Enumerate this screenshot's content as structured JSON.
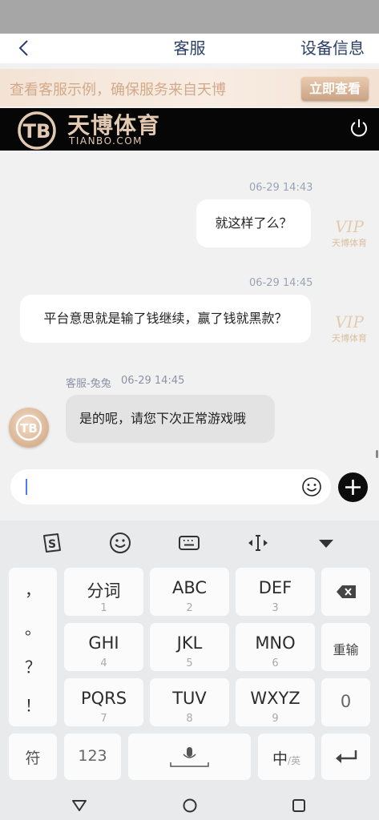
{
  "header": {
    "title": "客服",
    "right_action": "设备信息",
    "back_icon": "chevron-left-icon"
  },
  "promo": {
    "text": "查看客服示例，确保服务来自天博",
    "button": "立即查看"
  },
  "brand": {
    "name_cn": "天博体育",
    "name_en": "TIANBO.COM",
    "logo_letters": "TB"
  },
  "messages": [
    {
      "time": "06-29 14:43",
      "text": "就这样了么？",
      "side": "user"
    },
    {
      "time": "06-29 14:45",
      "text": "平台意思就是输了钱继续，赢了钱就黑款？",
      "side": "user"
    },
    {
      "sender": "客服-兔兔",
      "time": "06-29 14:45",
      "text": "是的呢，请您下次正常游戏哦",
      "side": "agent"
    }
  ],
  "vip_badge": {
    "text": "天博体育",
    "mark": "VIP"
  },
  "input": {
    "value": "",
    "placeholder": ""
  },
  "keyboard": {
    "toolbar": [
      "sogou-logo-icon",
      "emoji-icon",
      "keyboard-icon",
      "cursor-move-icon",
      "collapse-icon"
    ],
    "punctuation": [
      "，",
      "。",
      "？",
      "！"
    ],
    "keys": [
      {
        "main": "分词",
        "sub": "1"
      },
      {
        "main": "ABC",
        "sub": "2"
      },
      {
        "main": "DEF",
        "sub": "3"
      },
      {
        "main": "GHI",
        "sub": "4"
      },
      {
        "main": "JKL",
        "sub": "5"
      },
      {
        "main": "MNO",
        "sub": "6"
      },
      {
        "main": "PQRS",
        "sub": "7"
      },
      {
        "main": "TUV",
        "sub": "8"
      },
      {
        "main": "WXYZ",
        "sub": "9"
      }
    ],
    "right_keys": {
      "backspace": "backspace-icon",
      "retype": "重输",
      "zero": "0"
    },
    "bottom": {
      "symbols": "符",
      "numbers": "123",
      "lang_main": "中",
      "lang_sub": "/英"
    }
  },
  "colors": {
    "nav_text": "#2a3f66",
    "promo_gold": "#d3a98a",
    "brand_gold": "#e3c9b2",
    "agent_bubble": "#e3e3e3",
    "user_bubble": "#ffffff"
  }
}
